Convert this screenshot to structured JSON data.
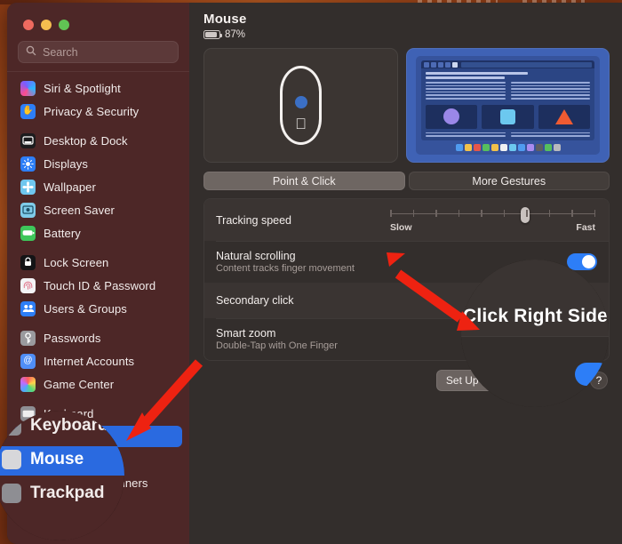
{
  "window": {
    "traffic_lights": [
      "close",
      "minimize",
      "zoom"
    ]
  },
  "search": {
    "placeholder": "Search",
    "value": "",
    "icon": "search-icon"
  },
  "sidebar": {
    "groups": [
      {
        "items": [
          {
            "label": "Siri & Spotlight",
            "icon": "siri-icon",
            "selected": false
          },
          {
            "label": "Privacy & Security",
            "icon": "shield-hand-icon",
            "selected": false
          }
        ]
      },
      {
        "items": [
          {
            "label": "Desktop & Dock",
            "icon": "desktop-dock-icon",
            "selected": false
          },
          {
            "label": "Displays",
            "icon": "display-brightness-icon",
            "selected": false
          },
          {
            "label": "Wallpaper",
            "icon": "wallpaper-icon",
            "selected": false
          },
          {
            "label": "Screen Saver",
            "icon": "screen-saver-icon",
            "selected": false
          },
          {
            "label": "Battery",
            "icon": "battery-icon",
            "selected": false
          }
        ]
      },
      {
        "items": [
          {
            "label": "Lock Screen",
            "icon": "lock-screen-icon",
            "selected": false
          },
          {
            "label": "Touch ID & Password",
            "icon": "fingerprint-icon",
            "selected": false
          },
          {
            "label": "Users & Groups",
            "icon": "users-groups-icon",
            "selected": false
          }
        ]
      },
      {
        "items": [
          {
            "label": "Passwords",
            "icon": "key-icon",
            "selected": false
          },
          {
            "label": "Internet Accounts",
            "icon": "at-sign-icon",
            "selected": false
          },
          {
            "label": "Game Center",
            "icon": "game-center-icon",
            "selected": false
          }
        ]
      },
      {
        "items": [
          {
            "label": "Keyboard",
            "icon": "keyboard-icon",
            "selected": false
          },
          {
            "label": "Mouse",
            "icon": "mouse-icon",
            "selected": true
          },
          {
            "label": "Trackpad",
            "icon": "trackpad-icon",
            "selected": false
          },
          {
            "label": "Printers & Scanners",
            "icon": "printer-icon",
            "selected": false
          }
        ]
      }
    ]
  },
  "main": {
    "title": "Mouse",
    "battery_percent": "87%",
    "battery_level": 87,
    "segmented": {
      "options": [
        "Point & Click",
        "More Gestures"
      ],
      "selected": "Point & Click"
    },
    "rows": [
      {
        "title": "Tracking speed",
        "subtitle": "",
        "control": "slider",
        "slider": {
          "min_label": "Slow",
          "max_label": "Fast",
          "ticks": 10,
          "value_index": 7
        }
      },
      {
        "title": "Natural scrolling",
        "subtitle": "Content tracks finger movement",
        "control": "toggle",
        "toggle_on": true
      },
      {
        "title": "Secondary click",
        "subtitle": "",
        "control": "popup",
        "popup_value": "Click Right Side"
      },
      {
        "title": "Smart zoom",
        "subtitle": "Double-Tap with One Finger",
        "control": "toggle",
        "toggle_on": true
      }
    ],
    "footer": {
      "setup_button": "Set Up Bluetooth Mouse…",
      "help_button": "?"
    }
  },
  "annotations": {
    "magnified_sidebar_items": [
      "Keyboard",
      "Mouse",
      "Trackpad"
    ],
    "magnified_popup_value": "Click Right Side",
    "arrow_color": "#ee2211",
    "circle_color": "#17100d"
  },
  "colors": {
    "accent": "#2a6ae0",
    "sidebar_bg": "#4d2727",
    "content_bg": "#332e2c",
    "row_alt_bg": "#3a3432",
    "desktop": "#9c4518",
    "toggle_on": "#2d7ef7"
  }
}
